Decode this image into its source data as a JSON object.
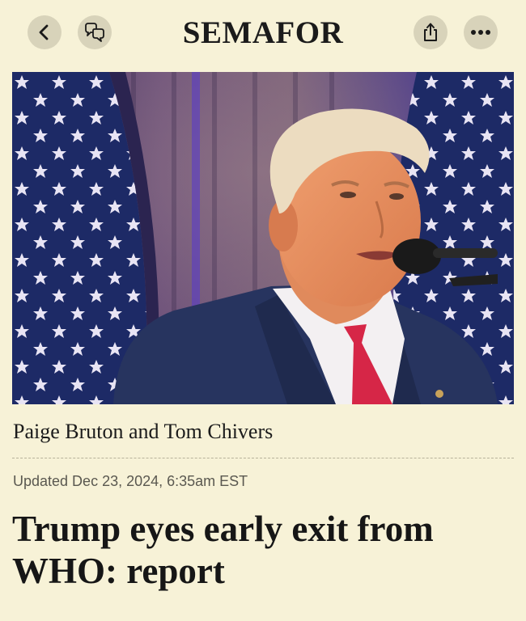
{
  "header": {
    "logo": "SEMAFOR",
    "back_icon": "chevron-left-icon",
    "comments_icon": "speech-bubbles-icon",
    "share_icon": "share-icon",
    "more_icon": "ellipsis-icon"
  },
  "article": {
    "hero_image": "photo of speaker at microphone in front of american flags",
    "byline": "Paige Bruton and Tom Chivers",
    "updated": "Updated Dec 23, 2024, 6:35am EST",
    "headline": "Trump eyes early exit from WHO: report"
  },
  "colors": {
    "background": "#f7f2d7",
    "button_bg": "#d8d3ba",
    "text": "#1b1b1b"
  }
}
